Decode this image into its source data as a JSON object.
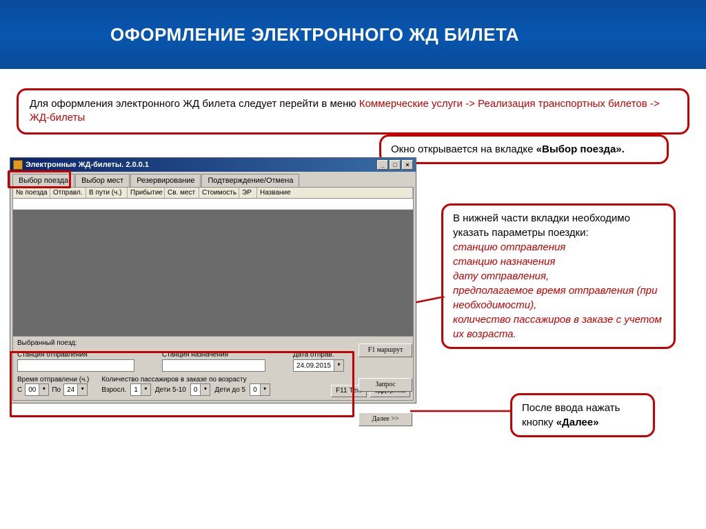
{
  "page_title": "ОФОРМЛЕНИЕ ЭЛЕКТРОННОГО ЖД БИЛЕТА",
  "info": {
    "text_black": "Для оформления электронного ЖД билета следует перейти в меню ",
    "text_red": "Коммерческие услуги -> Реализация транспортных билетов -> ЖД-билеты"
  },
  "callouts": {
    "top": {
      "prefix": "Окно открывается на вкладке ",
      "bold": "«Выбор поезда»."
    },
    "right": {
      "line1": "В нижней части вкладки необходимо указать параметры поездки:",
      "l2": "станцию отправления",
      "l3": "станцию назначения",
      "l4": "дату отправления,",
      "l5": "предполагаемое время отправления (при необходимости),",
      "l6": "количество пассажиров в заказе с учетом  их возраста."
    },
    "bottom": {
      "prefix": "После ввода нажать кнопку ",
      "bold": "«Далее»"
    }
  },
  "app": {
    "title": "Электронные ЖД-билеты. 2.0.0.1",
    "tabs": [
      "Выбор поезда",
      "Выбор мест",
      "Резервирование",
      "Подтверждение/Отмена"
    ],
    "grid_headers": [
      "№ поезда",
      "Отправл.",
      "В пути (ч.)",
      "Прибытие",
      "Св. мест",
      "Стоимость",
      "ЭР",
      "Название"
    ],
    "selected_train_label": "Выбранный поезд:",
    "departure_station_label": "Станция отправления",
    "destination_station_label": "Станция назначения",
    "departure_date_label": "Дата отправ.",
    "departure_date_value": "24.09.2015",
    "departure_time_label": "Время отправлени (ч.)",
    "from_label": "С",
    "from_value": "00",
    "to_label": "По",
    "to_value": "24",
    "passengers_label": "Количество пассажиров в заказе по возрасту",
    "adult_label": "Взросл.",
    "adult_value": "1",
    "child510_label": "Дети 5-10",
    "child510_value": "0",
    "child5_label": "Дети до 5",
    "child5_value": "0",
    "btn_route": "F1 маршрут",
    "btn_query": "Запрос",
    "btn_next": "Далее >>",
    "btn_support": "оддержка",
    "btn_tech": "F11 Тех."
  }
}
